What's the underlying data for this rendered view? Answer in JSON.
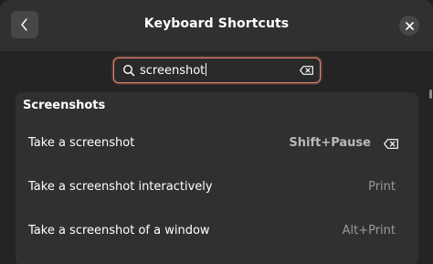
{
  "header": {
    "title": "Keyboard Shortcuts"
  },
  "icons": {
    "back": "chevron-left-icon",
    "close": "close-icon",
    "search": "search-icon",
    "clear": "backspace-icon",
    "reset": "backspace-icon"
  },
  "search": {
    "value": "screenshot",
    "accent_color": "#e0856b"
  },
  "section": {
    "title": "Screenshots",
    "shortcuts": [
      {
        "label": "Take a screenshot",
        "accel": "Shift+Pause",
        "customized": true
      },
      {
        "label": "Take a screenshot interactively",
        "accel": "Print",
        "customized": false
      },
      {
        "label": "Take a screenshot of a window",
        "accel": "Alt+Print",
        "customized": false
      }
    ]
  },
  "colors": {
    "background": "#242424",
    "headerbar": "#303030",
    "card": "#303030"
  }
}
